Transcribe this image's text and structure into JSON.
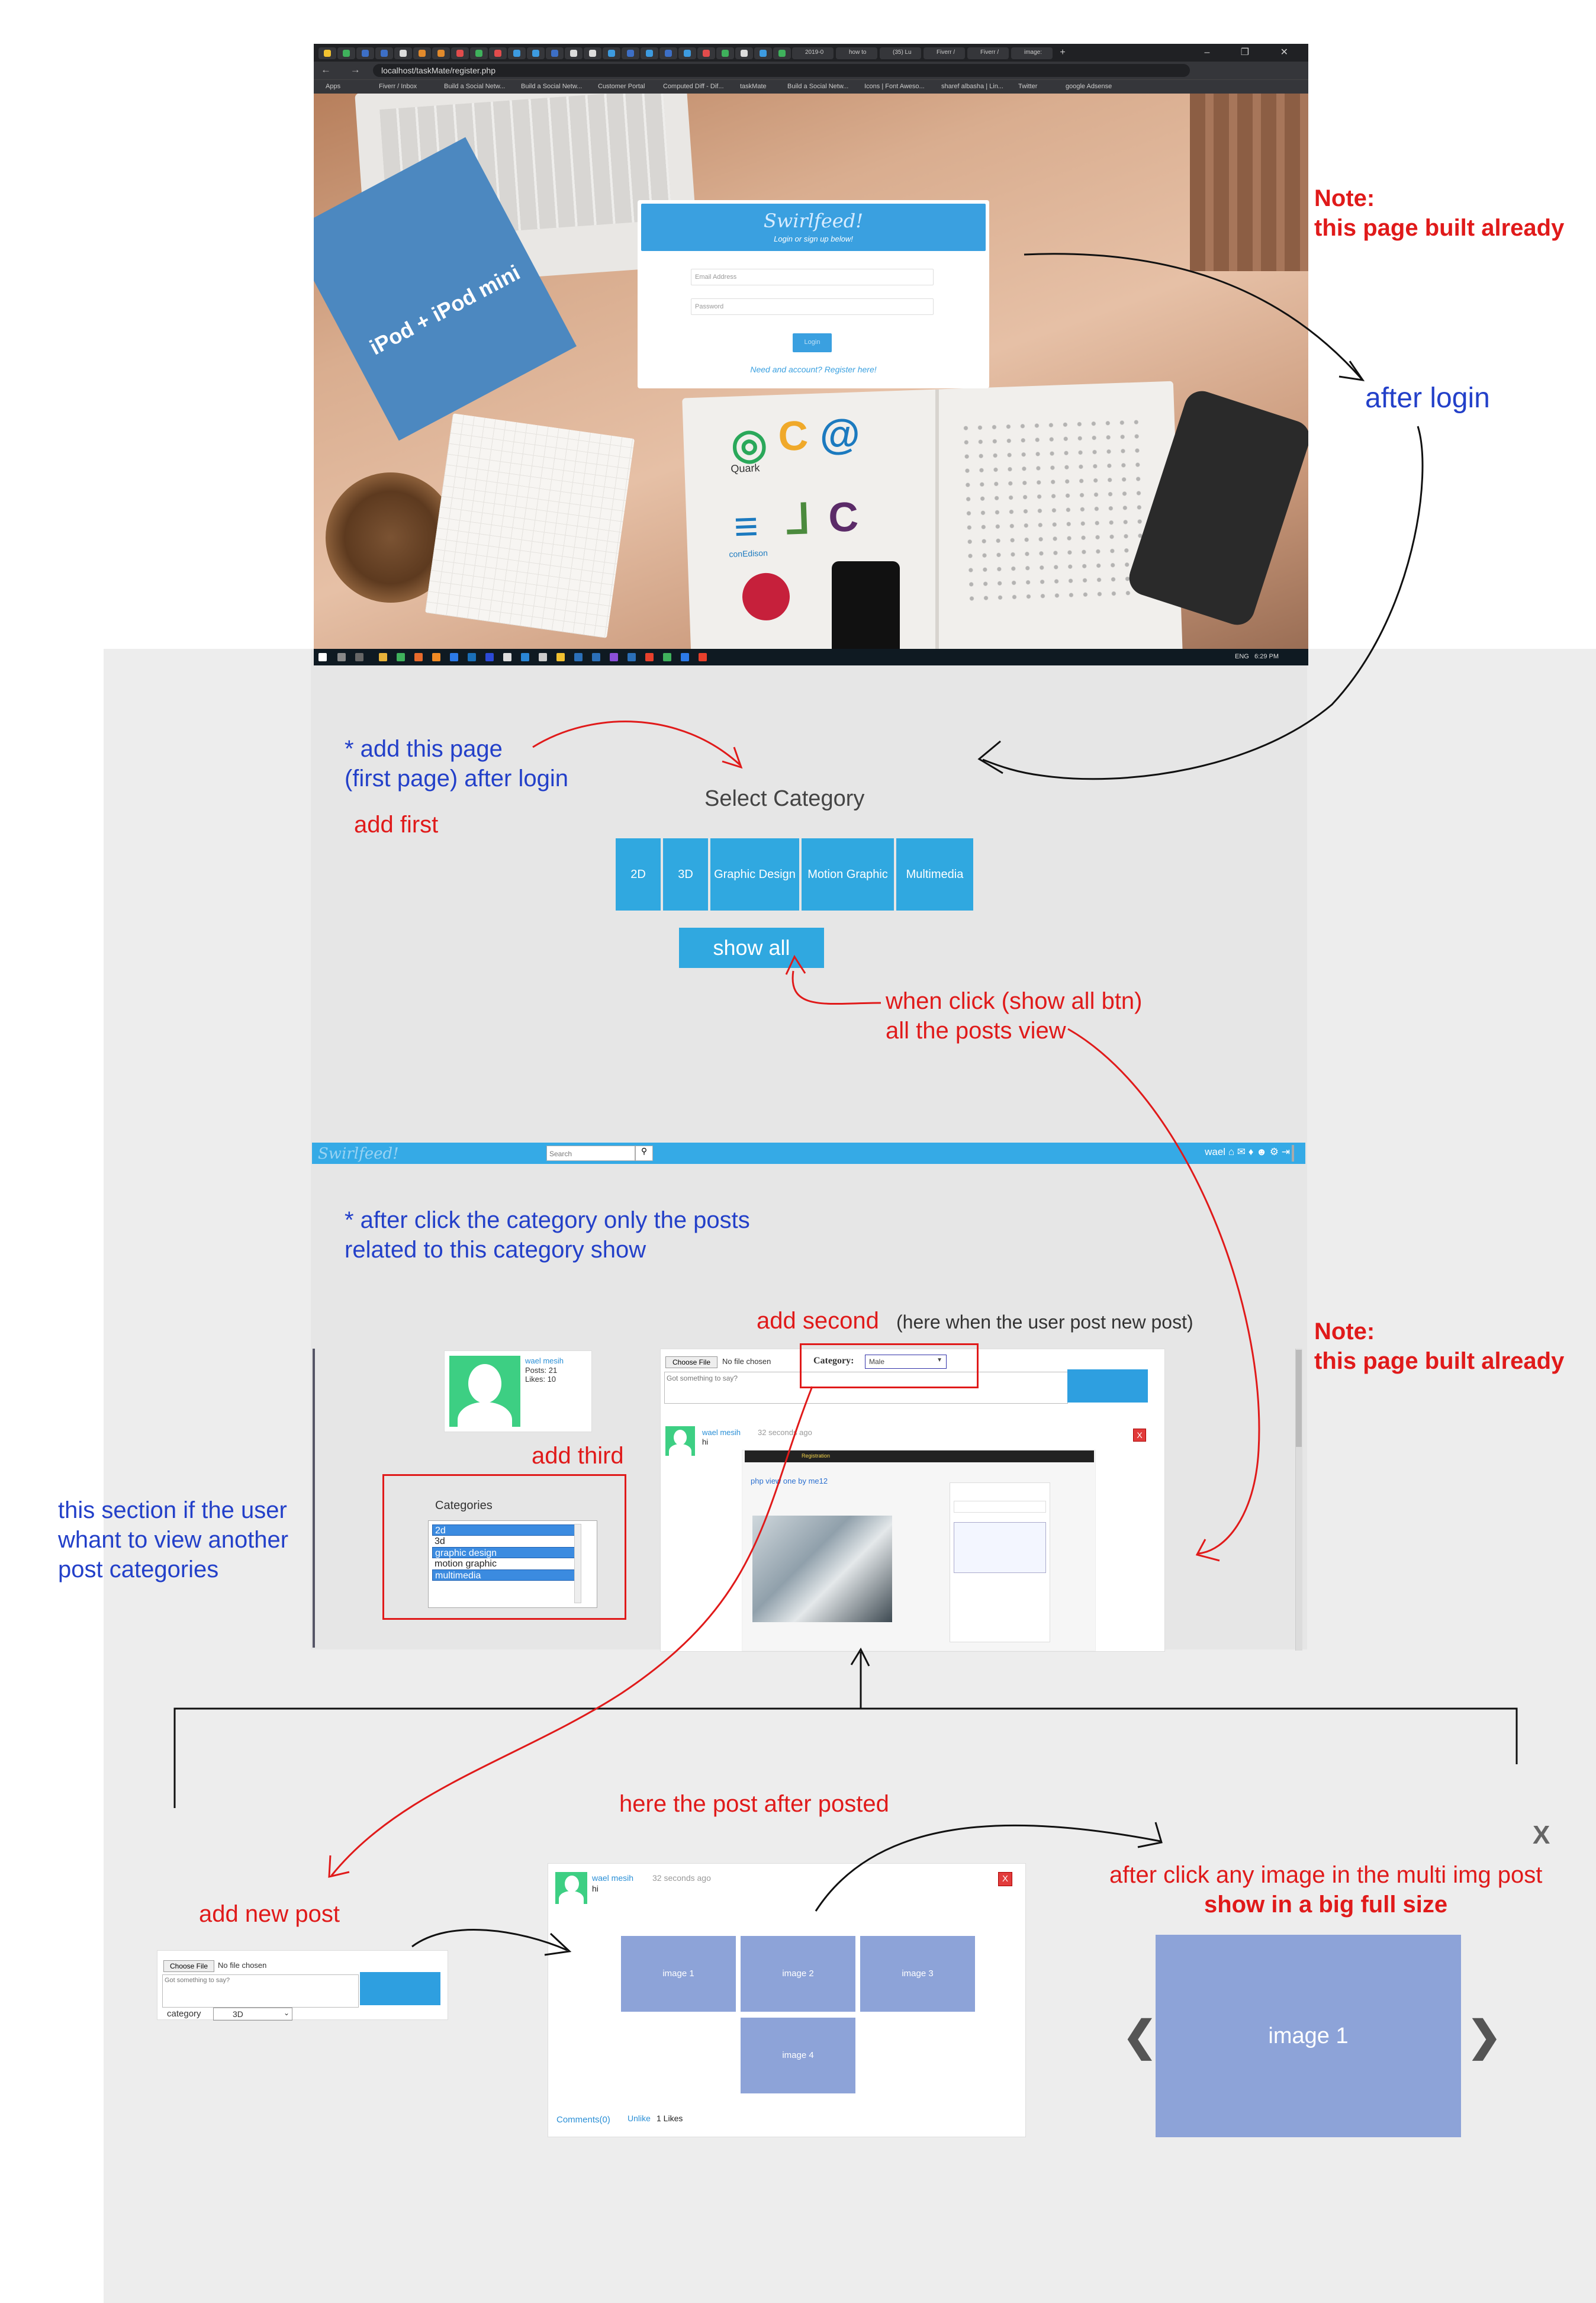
{
  "browser": {
    "url": "localhost/taskMate/register.php",
    "window_controls": "–  ❐  ✕",
    "nav_controls": "← → C",
    "tabs": [
      "2019-0",
      "how to",
      "(35) Lu",
      "Fiverr /",
      "Fiverr /",
      "image:"
    ],
    "bookmarks": [
      "Apps",
      "Fiverr / Inbox",
      "Build a Social Netw...",
      "Build a Social Netw...",
      "Customer Portal",
      "Computed Diff - Dif...",
      "taskMate",
      "Build a Social Netw...",
      "Icons | Font Aweso...",
      "sharef albasha | Lin...",
      "Twitter",
      "google Adsense"
    ],
    "desk_logos": {
      "quark": "Quark",
      "conedison": "conEdison",
      "ipod": "iPod + iPod mini"
    },
    "login": {
      "title": "Swirlfeed!",
      "subtitle": "Login or sign up below!",
      "email_placeholder": "Email Address",
      "password_placeholder": "Password",
      "button": "Login",
      "register_link": "Need and account? Register here!"
    },
    "taskbar": {
      "lang": "ENG",
      "time": "6:29 PM"
    }
  },
  "annotations": {
    "note1_title": "Note:",
    "note1_text": "this page built already",
    "after_login": "after login",
    "add_page_line1": "* add this page",
    "add_page_line2": "(first page) after login",
    "add_first": "add first",
    "when_click_line1": "when click (show all btn)",
    "when_click_line2": "all the posts view",
    "after_click_line1": "* after click the category only the posts",
    "after_click_line2": "related to this category show",
    "add_second": "add second",
    "here_when": "(here when the user post new post)",
    "note2_title": "Note:",
    "note2_text": "this page built already",
    "add_third": "add third",
    "section_line1": "this section if the user",
    "section_line2": "whant to view another",
    "section_line3": "post categories",
    "here_post": "here the post after posted",
    "add_new_post": "add new post",
    "after_img_line1": "after click any image in the multi img post",
    "after_img_line2": "show in a big full size"
  },
  "category_page": {
    "title": "Select Category",
    "categories": [
      "2D",
      "3D",
      "Graphic Design",
      "Motion Graphic",
      "Multimedia"
    ],
    "show_all": "show all"
  },
  "posts_page": {
    "logo": "Swirlfeed!",
    "search_placeholder": "Search",
    "search_icon": "magnifier-icon",
    "nav_user": "wael",
    "nav_icons": "⌂ ✉ ♦ ☻ ⚙ ⇥",
    "profile": {
      "name": "wael mesih",
      "posts": "Posts: 21",
      "likes": "Likes: 10"
    },
    "categories_label": "Categories",
    "categories_list": [
      {
        "label": "2d",
        "selected": true
      },
      {
        "label": "3d",
        "selected": false
      },
      {
        "label": "graphic design",
        "selected": true
      },
      {
        "label": "motion graphic",
        "selected": false
      },
      {
        "label": "multimedia",
        "selected": true
      }
    ],
    "choose_file": "Choose File",
    "no_file": "No file chosen",
    "textarea_placeholder": "Got something to say?",
    "category_label": "Category:",
    "category_value": "Male",
    "post": {
      "author": "wael mesih",
      "time": "32 seconds ago",
      "text": "hi",
      "delete": "X",
      "embed_title": "php view one by me12",
      "embed_nav": "Registration"
    }
  },
  "new_post": {
    "choose_file": "Choose File",
    "no_file": "No file chosen",
    "placeholder": "Got something to say?",
    "category_label": "category",
    "category_value": "3D"
  },
  "posted_card": {
    "author": "wael mesih",
    "time": "32 seconds ago",
    "text": "hi",
    "delete": "X",
    "images": [
      "image 1",
      "image 2",
      "image 3",
      "image 4"
    ],
    "comments": "Comments(0)",
    "unlike": "Unlike",
    "likes": "1 Likes"
  },
  "lightbox": {
    "image": "image 1",
    "prev": "❮",
    "next": "❯",
    "close": "X"
  }
}
